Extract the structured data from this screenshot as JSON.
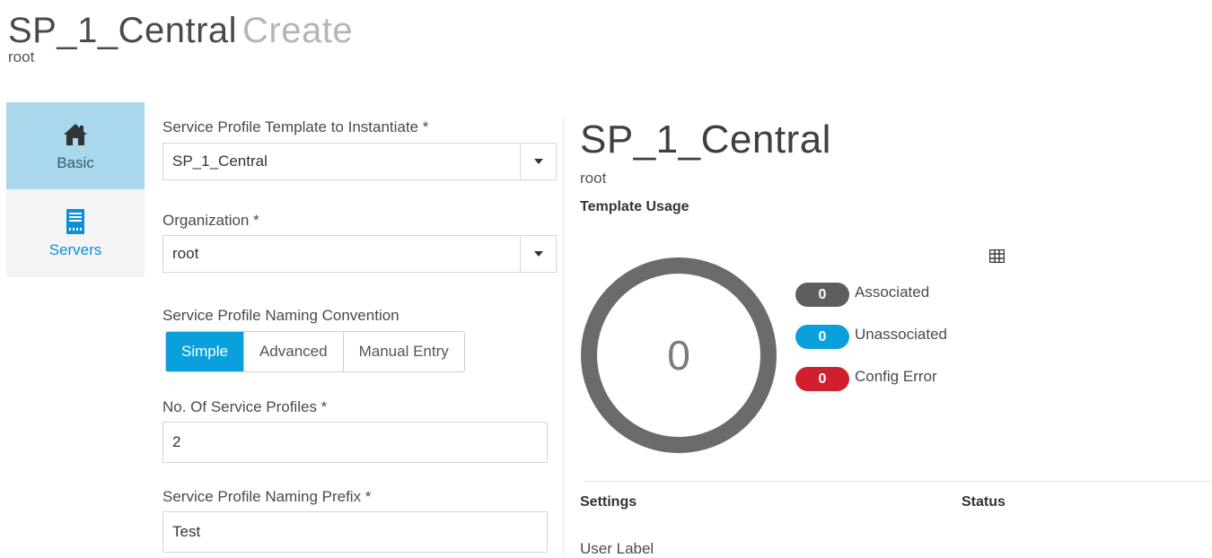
{
  "header": {
    "name": "SP_1_Central",
    "action": "Create",
    "org": "root"
  },
  "sidebar": {
    "items": [
      {
        "label": "Basic",
        "icon": "home-icon"
      },
      {
        "label": "Servers",
        "icon": "server-icon"
      }
    ]
  },
  "form": {
    "template": {
      "label": "Service Profile Template to Instantiate *",
      "value": "SP_1_Central"
    },
    "organization": {
      "label": "Organization *",
      "value": "root"
    },
    "naming_convention": {
      "label": "Service Profile Naming Convention",
      "options": [
        "Simple",
        "Advanced",
        "Manual Entry"
      ],
      "selected": "Simple"
    },
    "count": {
      "label": "No. Of Service Profiles  *",
      "value": "2"
    },
    "prefix": {
      "label": "Service Profile Naming Prefix *",
      "value": "Test"
    }
  },
  "summary": {
    "title": "SP_1_Central",
    "org": "root",
    "section": "Template Usage",
    "total": "0",
    "legend": [
      {
        "count": "0",
        "label": "Associated",
        "color": "#5e5e5e"
      },
      {
        "count": "0",
        "label": "Unassociated",
        "color": "#0aa0dc"
      },
      {
        "count": "0",
        "label": "Config Error",
        "color": "#d0202e"
      }
    ],
    "table": {
      "col_settings": "Settings",
      "col_status": "Status",
      "row_user_label": "User Label"
    }
  },
  "colors": {
    "accent": "#0aa0dc",
    "active_tab": "#a9d8ec",
    "donut": "#6b6b6b"
  }
}
